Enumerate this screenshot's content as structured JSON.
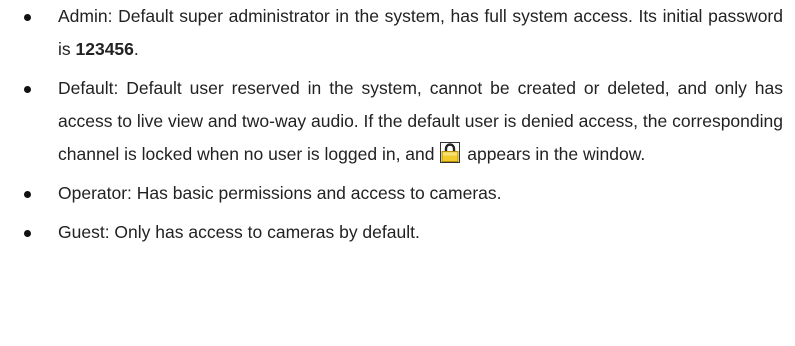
{
  "roles": [
    {
      "text_before": "Admin: Default super administrator in the system, has full system access. Its initial password is ",
      "password": "123456",
      "text_after": "."
    },
    {
      "text_before": "Default: Default user reserved in the system, cannot be created or deleted, and only has access to live view and two-way audio. If the default user is denied access, the corresponding channel is locked when no user is logged in, and ",
      "icon": "lock-icon",
      "text_after": " appears in the window."
    },
    {
      "text": "Operator: Has basic permissions and access to cameras."
    },
    {
      "text": "Guest: Only has access to cameras by default."
    }
  ],
  "colors": {
    "text": "#222222",
    "lock_body": "#f2cc2c",
    "lock_shackle": "#222222"
  }
}
